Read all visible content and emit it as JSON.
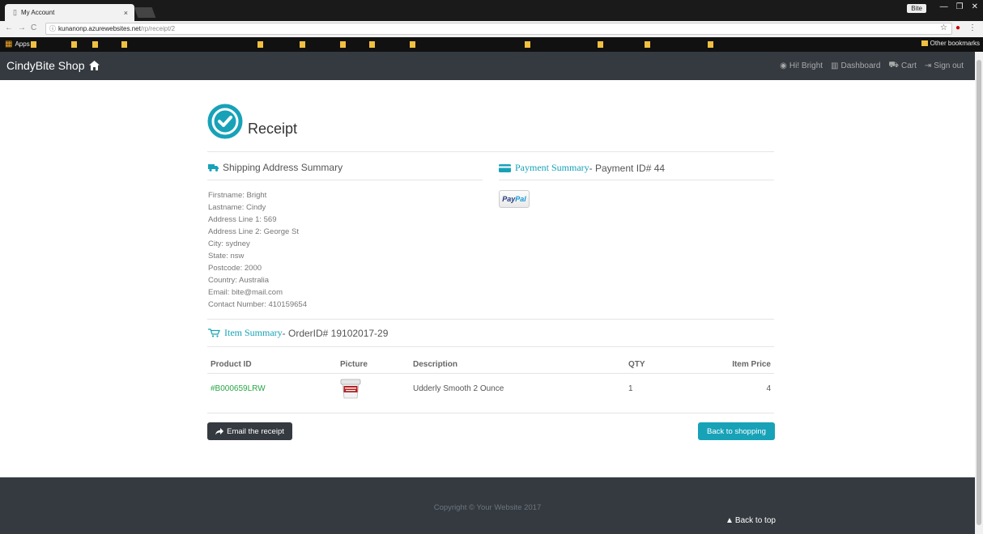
{
  "browser": {
    "tab_title": "My Account",
    "tab_close": "×",
    "url_host": "kunanonp.azurewebsites.net",
    "url_path": "/rp/receipt/2",
    "profile_name": "Bite",
    "apps_label": "Apps",
    "other_bookmarks": "Other bookmarks"
  },
  "navbar": {
    "brand": "CindyBite Shop",
    "greeting": "Hi! Bright",
    "dashboard": "Dashboard",
    "cart": "Cart",
    "sign_out": "Sign out"
  },
  "receipt": {
    "title": "Receipt",
    "shipping_title": "Shipping Address Summary",
    "payment_title_link": "Payment Summary",
    "payment_title_rest": " - Payment ID# 44",
    "address_lines": [
      "Firstname: Bright",
      "Lastname: Cindy",
      "Address Line 1: 569",
      "Address Line 2: George St",
      "City: sydney",
      "State: nsw",
      "Postcode: 2000",
      "Country: Australia",
      "Email: bite@mail.com",
      "Contact Number: 410159654"
    ],
    "paypal_a": "Pay",
    "paypal_b": "Pal",
    "item_title_link": "Item Summary",
    "item_title_rest": " - OrderID# 19102017-29",
    "columns": {
      "product_id": "Product ID",
      "picture": "Picture",
      "description": "Description",
      "qty": "QTY",
      "item_price": "Item Price"
    },
    "items": [
      {
        "product_id": "#B000659LRW",
        "description": "Udderly Smooth 2 Ounce",
        "qty": "1",
        "price": "4"
      }
    ],
    "email_button": "Email the receipt",
    "back_button": "Back to shopping"
  },
  "footer": {
    "copyright": "Copyright © Your Website 2017",
    "back_to_top": "Back to top"
  },
  "colors": {
    "accent": "#17a2b8",
    "navbar": "#343a40",
    "link_green": "#28a745"
  }
}
